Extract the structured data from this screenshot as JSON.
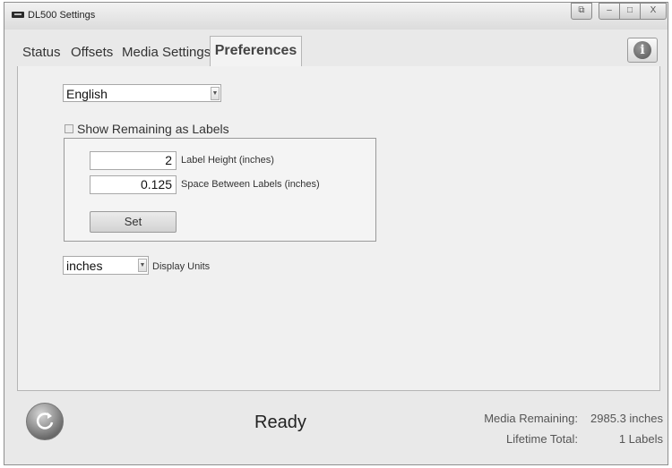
{
  "window": {
    "title": "DL500 Settings",
    "buttons": {
      "help": "⧉",
      "minimize": "–",
      "maximize": "□",
      "close": "X"
    }
  },
  "tabs": [
    {
      "label": "Status",
      "active": false
    },
    {
      "label": "Offsets",
      "active": false
    },
    {
      "label": "Media Settings",
      "active": false
    },
    {
      "label": "Preferences",
      "active": true
    }
  ],
  "info_button": {
    "glyph": "i",
    "icon": "info-icon"
  },
  "preferences": {
    "language": {
      "selected": "English"
    },
    "show_remaining_as_labels": {
      "label": "Show Remaining as Labels",
      "checked": false
    },
    "label_height": {
      "value": "2",
      "label": "Label Height (inches)"
    },
    "space_between_labels": {
      "value": "0.125",
      "label": "Space Between Labels (inches)"
    },
    "set_button": "Set",
    "display_units": {
      "selected": "inches",
      "label": "Display Units"
    }
  },
  "footer": {
    "refresh_icon": "refresh-icon",
    "status": "Ready",
    "media_remaining": {
      "label": "Media Remaining:",
      "value": "2985.3 inches"
    },
    "lifetime_total": {
      "label": "Lifetime Total:",
      "value": "1 Labels"
    }
  }
}
